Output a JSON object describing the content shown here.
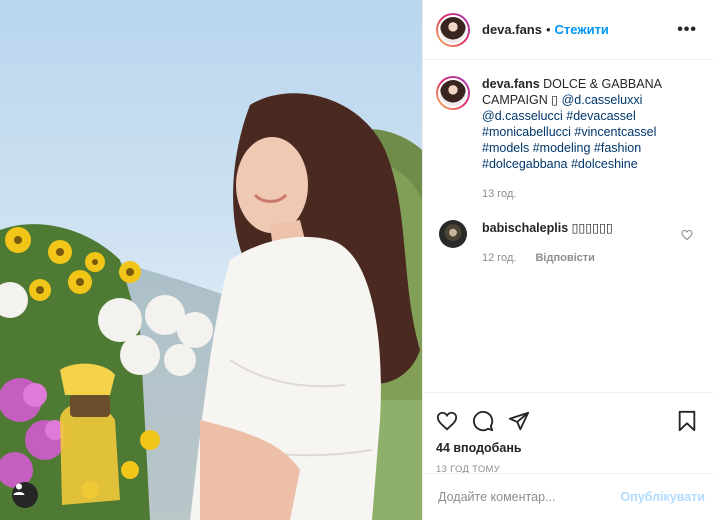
{
  "header": {
    "username": "deva.fans",
    "separator": "•",
    "follow_label": "Стежити",
    "more_icon": "more-options-icon",
    "more_label": "•••"
  },
  "caption": {
    "username": "deva.fans",
    "text_1": "DOLCE & GABBANA CAMPAIGN ▯",
    "mention_1": "@d.casseluxxi",
    "mention_2": "@d.casselucci",
    "tags": [
      "#devacassel",
      "#monicabellucci",
      "#vincentcassel",
      "#models",
      "#modeling",
      "#fashion",
      "#dolcegabbana",
      "#dolceshine"
    ],
    "time": "13 год."
  },
  "comment": {
    "username": "babischaleplis",
    "text": "▯▯▯▯▯▯",
    "time": "12 год.",
    "reply_label": "Відповісти"
  },
  "actions": {
    "likes": "44 вподобань",
    "timestamp": "13 ГОД ТОМУ"
  },
  "add_comment": {
    "placeholder": "Додайте коментар...",
    "publish_label": "Опублікувати"
  },
  "colors": {
    "link": "#0095f6",
    "tag": "#00376b",
    "muted": "#8e8e8e",
    "publish_disabled": "#b3dbff"
  }
}
